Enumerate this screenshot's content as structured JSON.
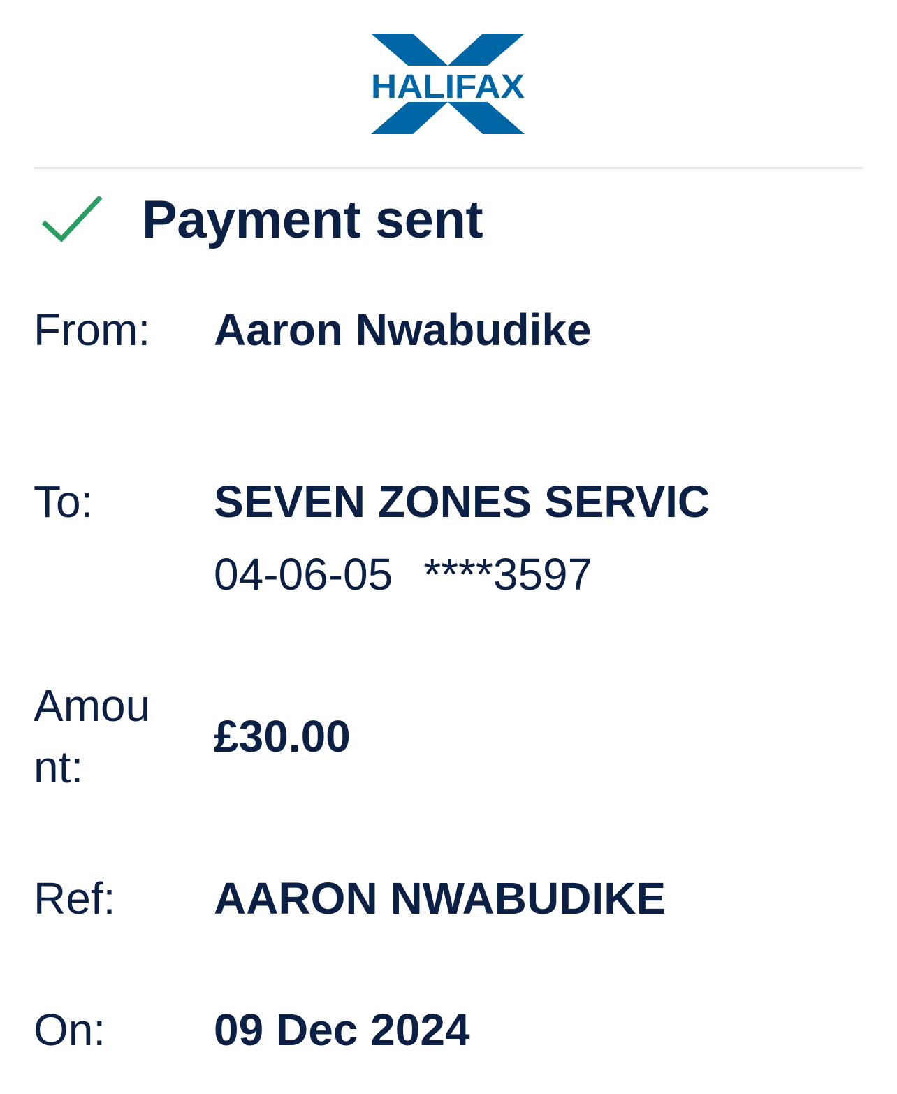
{
  "brand": {
    "name": "HALIFAX",
    "color": "#0066a6"
  },
  "status": {
    "icon": "checkmark-icon",
    "icon_color": "#2a9d63",
    "title": "Payment sent"
  },
  "details": {
    "from": {
      "label": "From:",
      "value": "Aaron Nwabudike"
    },
    "to": {
      "label": "To:",
      "value": "SEVEN ZONES SERVIC",
      "sort_code": "04-06-05",
      "account_number": "****3597"
    },
    "amount": {
      "label": "Amount:",
      "value": "£30.00"
    },
    "ref": {
      "label": "Ref:",
      "value": "AARON NWABUDIKE"
    },
    "on": {
      "label": "On:",
      "value": "09 Dec 2024"
    }
  }
}
